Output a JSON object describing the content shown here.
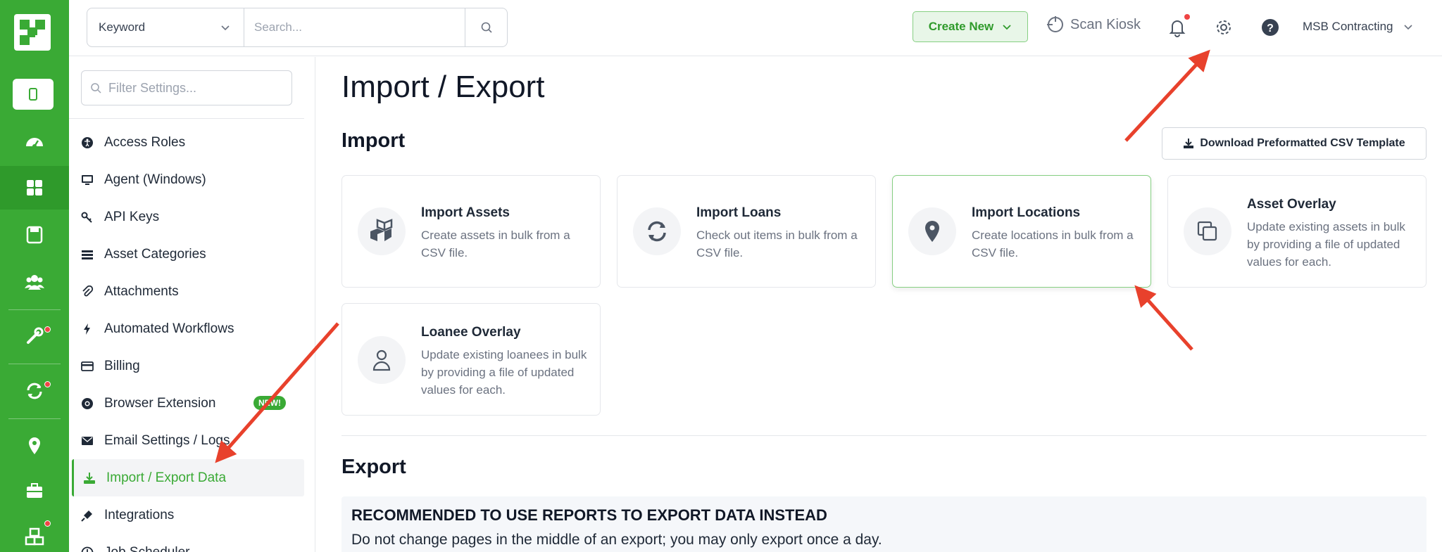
{
  "topbar": {
    "keyword_label": "Keyword",
    "search_placeholder": "Search...",
    "create_new": "Create New",
    "scan_kiosk": "Scan Kiosk",
    "org_name": "MSB Contracting"
  },
  "settings": {
    "filter_placeholder": "Filter Settings...",
    "items": [
      {
        "label": "Access Roles",
        "icon": "universal-access-icon"
      },
      {
        "label": "Agent (Windows)",
        "icon": "monitor-icon"
      },
      {
        "label": "API Keys",
        "icon": "key-icon"
      },
      {
        "label": "Asset Categories",
        "icon": "list-icon"
      },
      {
        "label": "Attachments",
        "icon": "paperclip-icon"
      },
      {
        "label": "Automated Workflows",
        "icon": "bolt-icon"
      },
      {
        "label": "Billing",
        "icon": "credit-card-icon"
      },
      {
        "label": "Browser Extension",
        "icon": "chrome-icon",
        "badge": "NEW!"
      },
      {
        "label": "Email Settings / Logs",
        "icon": "envelope-icon"
      },
      {
        "label": "Import / Export Data",
        "icon": "download-icon",
        "active": true
      },
      {
        "label": "Integrations",
        "icon": "plug-icon"
      },
      {
        "label": "Job Scheduler",
        "icon": "clock-icon"
      }
    ]
  },
  "main": {
    "page_title": "Import / Export",
    "import_heading": "Import",
    "download_button": "Download Preformatted CSV Template",
    "cards": [
      {
        "title": "Import Assets",
        "desc": "Create assets in bulk from a CSV file.",
        "icon": "cubes-icon"
      },
      {
        "title": "Import Loans",
        "desc": "Check out items in bulk from a CSV file.",
        "icon": "sync-icon"
      },
      {
        "title": "Import Locations",
        "desc": "Create locations in bulk from a CSV file.",
        "icon": "map-pin-icon"
      },
      {
        "title": "Asset Overlay",
        "desc": "Update existing assets in bulk by providing a file of updated values for each.",
        "icon": "copy-icon"
      },
      {
        "title": "Loanee Overlay",
        "desc": "Update existing loanees in bulk by providing a file of updated values for each.",
        "icon": "user-icon"
      }
    ],
    "export_heading": "Export",
    "notice_title": "RECOMMENDED TO USE REPORTS TO EXPORT DATA INSTEAD",
    "notice_body": "Do not change pages in the middle of an export; you may only export once a day."
  },
  "colors": {
    "brand_green": "#3aaa35",
    "annotation_red": "#e8412c",
    "badge_red": "#ef4444"
  }
}
